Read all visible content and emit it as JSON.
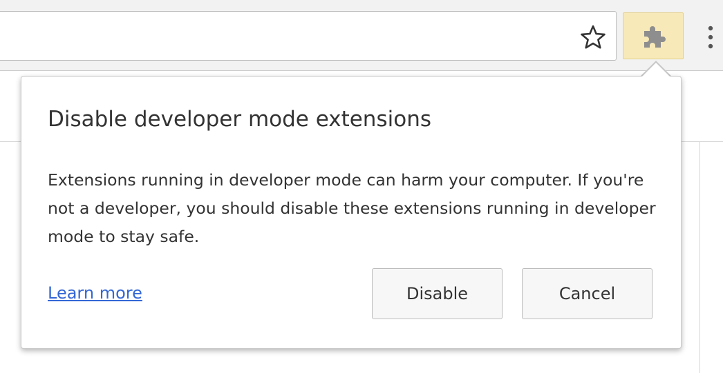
{
  "toolbar": {
    "icons": {
      "bookmark": "star-icon",
      "extension": "puzzle-piece-icon",
      "menu": "more-vertical-icon"
    },
    "extension_button_color": "#f7e9b8"
  },
  "bubble": {
    "title": "Disable developer mode extensions",
    "body": "Extensions running in developer mode can harm your computer. If you're not a developer, you should disable these extensions running in developer mode to stay safe.",
    "learn_more": "Learn more",
    "disable_label": "Disable",
    "cancel_label": "Cancel",
    "link_color": "#3367d6"
  }
}
